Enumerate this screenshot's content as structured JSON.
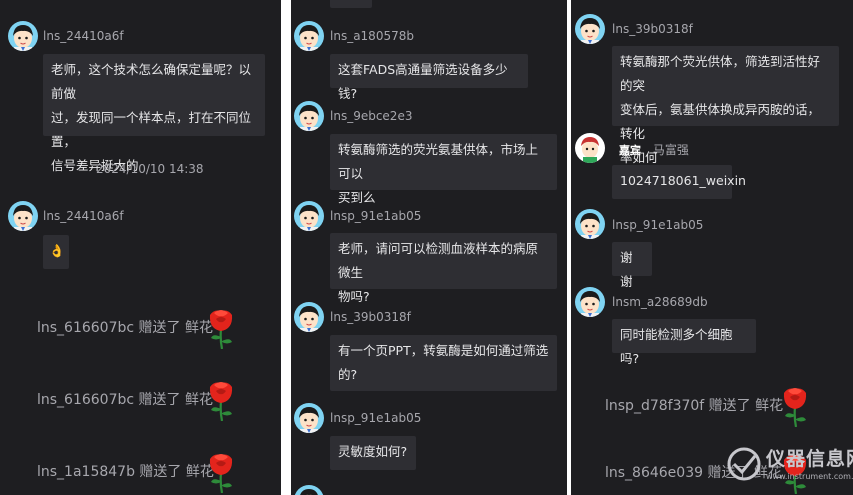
{
  "col1": {
    "m1_user": "lns_24410a6f",
    "m1_text_l1": "老师，这个技术怎么确保定量呢？以前做",
    "m1_text_l2": "过，发现同一个样本点，打在不同位置，",
    "m1_text_l3": "信号差异挺大的",
    "timestamp": "2024/10/10 14:38",
    "m2_user": "lns_24410a6f",
    "m2_text": "👌",
    "g1_text": "lns_616607bc 赠送了 鲜花",
    "g2_text": "lns_616607bc 赠送了 鲜花",
    "g3_text": "lns_1a15847b 赠送了 鲜花"
  },
  "col2": {
    "m1_user": "lns_a180578b",
    "m1_text": "这套FADS高通量筛选设备多少钱?",
    "m2_user": "lns_9ebce2e3",
    "m2_text_l1": "转氨酶筛选的荧光氨基供体，市场上可以",
    "m2_text_l2": "买到么",
    "m3_user": "lnsp_91e1ab05",
    "m3_text_l1": "老师，请问可以检测血液样本的病原微生",
    "m3_text_l2": "物吗?",
    "m4_user": "lns_39b0318f",
    "m4_text_l1": "有一个页PPT，转氨酶是如何通过筛选",
    "m4_text_l2": "的?",
    "m5_user": "lnsp_91e1ab05",
    "m5_text": "灵敏度如何?"
  },
  "col3": {
    "m1_user": "lns_39b0318f",
    "m1_text_l1": "转氨酶那个荧光供体，筛选到活性好的突",
    "m1_text_l2": "变体后，氨基供体换成异丙胺的话，转化",
    "m1_text_l3": "率如何",
    "m2_badge": "嘉宾",
    "m2_user": "马富强",
    "m2_text": "1024718061_weixin",
    "m3_user": "lnsp_91e1ab05",
    "m3_text": "谢谢",
    "m4_user": "lnsm_a28689db",
    "m4_text": "同时能检测多个细胞吗?",
    "g1_text": "lnsp_d78f370f 赠送了 鲜花",
    "g2_text": "lns_8646e039 赠送了 鲜花"
  },
  "watermark": {
    "title": "仪器信息网",
    "url": "www.instrument.com.cn"
  },
  "colors": {
    "panel_bg": "#1e1e21",
    "bubble_bg": "#2e2e33",
    "text": "#e6e6e8",
    "muted": "#a7a7ad",
    "rose": "#e3241c"
  }
}
